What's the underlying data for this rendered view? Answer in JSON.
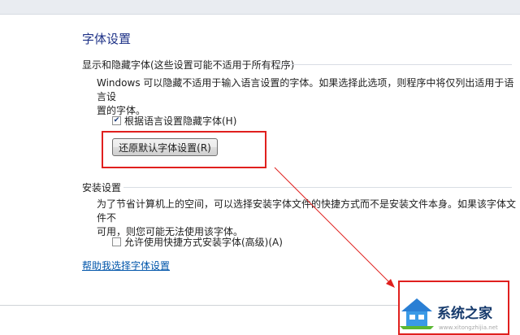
{
  "header": {
    "title": "字体设置"
  },
  "hide_section": {
    "title": "显示和隐藏字体(这些设置可能不适用于所有程序)",
    "desc_line1": "Windows 可以隐藏不适用于输入语言设置的字体。如果选择此选项，则程序中将仅列出适用于语言设",
    "desc_line2": "置的字体。",
    "checkbox_label": "根据语言设置隐藏字体(H)",
    "checkbox_checked": true,
    "restore_button": "还原默认字体设置(R)"
  },
  "install_section": {
    "title": "安装设置",
    "desc_line1": "为了节省计算机上的空间，可以选择安装字体文件的快捷方式而不是安装文件本身。如果该字体文件不",
    "desc_line2": "可用，则您可能无法使用该字体。",
    "checkbox_label": "允许使用快捷方式安装字体(高级)(A)",
    "checkbox_checked": false
  },
  "help_link": "帮助我选择字体设置",
  "watermark": {
    "text": "系统之家",
    "url": "www.xitongzhijia.net"
  },
  "colors": {
    "annotation": "#e0201e",
    "link": "#0055aa",
    "title": "#1e3287"
  }
}
